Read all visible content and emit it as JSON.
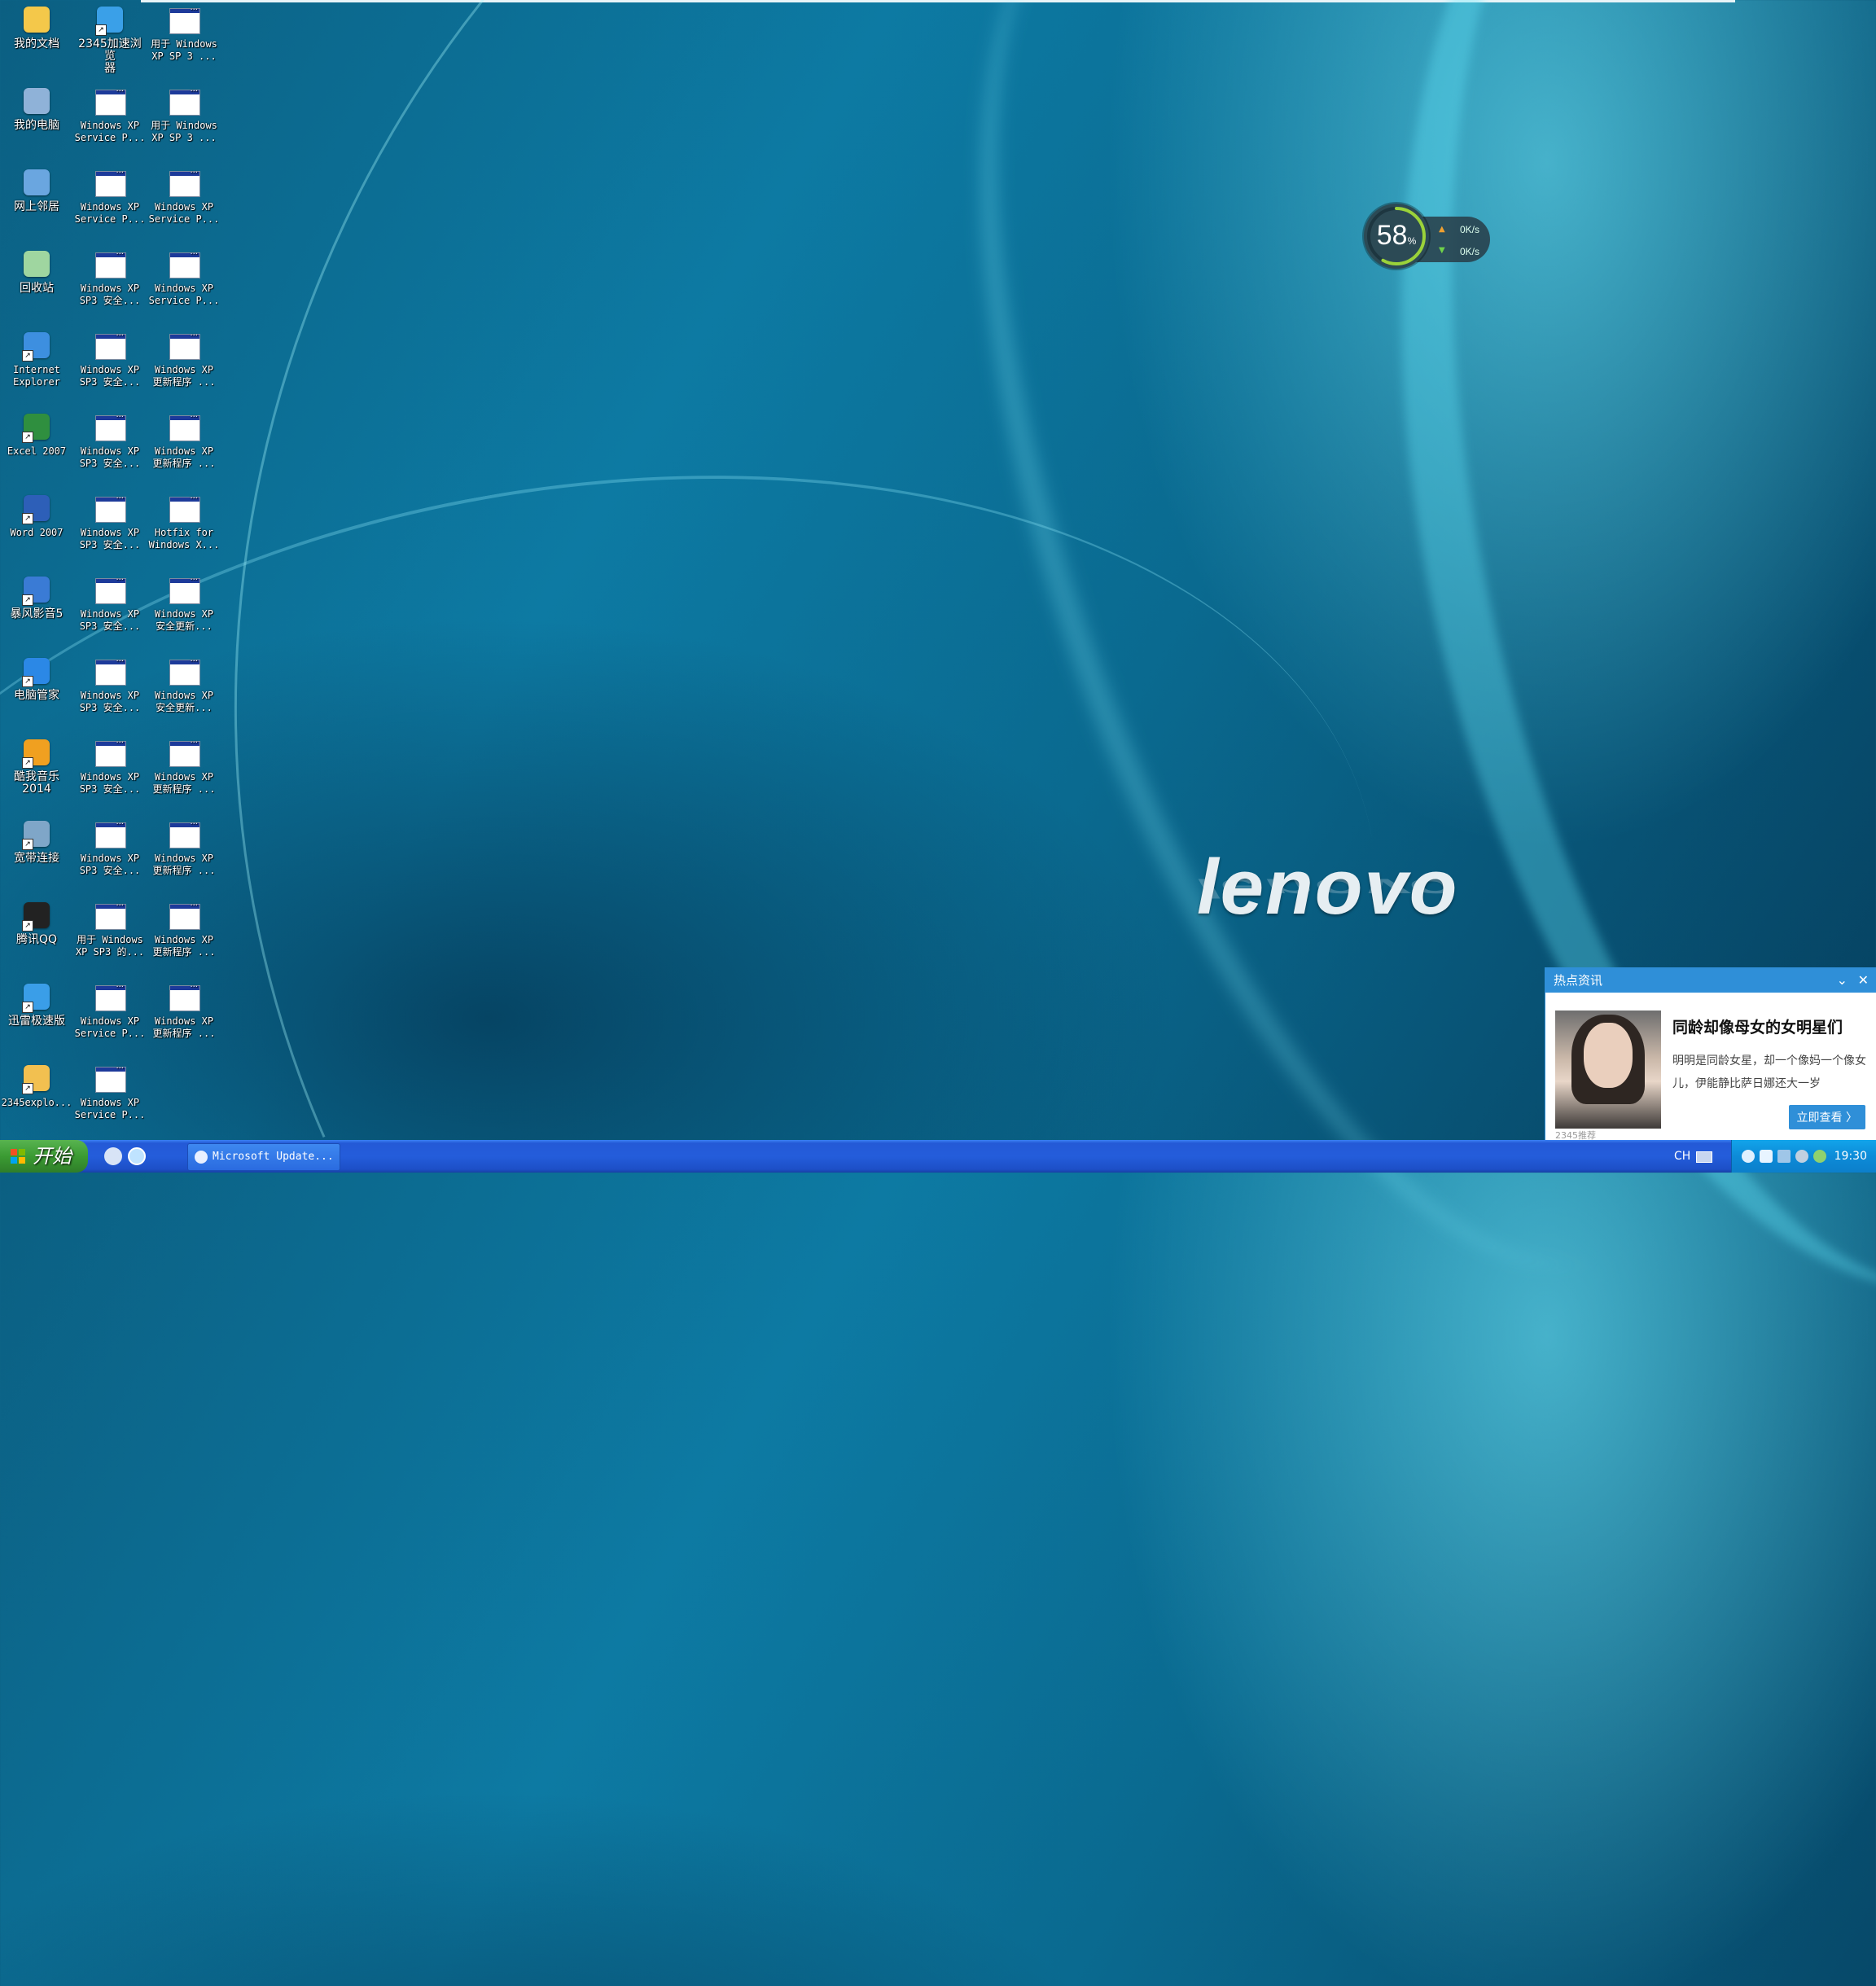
{
  "desktop": {
    "col1": [
      {
        "label": "我的文档",
        "icon": "my-documents-icon"
      },
      {
        "label": "我的电脑",
        "icon": "my-computer-icon"
      },
      {
        "label": "网上邻居",
        "icon": "network-places-icon"
      },
      {
        "label": "回收站",
        "icon": "recycle-bin-icon"
      },
      {
        "label": "Internet\nExplorer",
        "icon": "internet-explorer-icon"
      },
      {
        "label": "Excel 2007",
        "icon": "excel-icon"
      },
      {
        "label": "Word 2007",
        "icon": "word-icon"
      },
      {
        "label": "暴风影音5",
        "icon": "baofeng-player-icon"
      },
      {
        "label": "电脑管家",
        "icon": "pc-manager-icon"
      },
      {
        "label": "酷我音乐\n2014",
        "icon": "kuwo-music-icon"
      },
      {
        "label": "宽带连接",
        "icon": "broadband-icon"
      },
      {
        "label": "腾讯QQ",
        "icon": "qq-icon"
      },
      {
        "label": "迅雷极速版",
        "icon": "thunder-icon"
      },
      {
        "label": "2345explo...",
        "icon": "2345-explorer-icon"
      }
    ],
    "col2": [
      {
        "label": "2345加速浏览\n器",
        "icon": "2345-browser-icon"
      },
      {
        "label": "Windows XP\nService P...",
        "icon": "installer-window-icon"
      },
      {
        "label": "Windows XP\nService P...",
        "icon": "installer-window-icon"
      },
      {
        "label": "Windows XP\nSP3 安全...",
        "icon": "installer-window-icon"
      },
      {
        "label": "Windows XP\nSP3 安全...",
        "icon": "installer-window-icon"
      },
      {
        "label": "Windows XP\nSP3 安全...",
        "icon": "installer-window-icon"
      },
      {
        "label": "Windows XP\nSP3 安全...",
        "icon": "installer-window-icon"
      },
      {
        "label": "Windows XP\nSP3 安全...",
        "icon": "installer-window-icon"
      },
      {
        "label": "Windows XP\nSP3 安全...",
        "icon": "installer-window-icon"
      },
      {
        "label": "Windows XP\nSP3 安全...",
        "icon": "installer-window-icon"
      },
      {
        "label": "Windows XP\nSP3 安全...",
        "icon": "installer-window-icon"
      },
      {
        "label": "用于 Windows\nXP SP3 的...",
        "icon": "installer-window-icon"
      },
      {
        "label": "Windows XP\nService P...",
        "icon": "installer-window-icon"
      },
      {
        "label": "Windows XP\nService P...",
        "icon": "installer-window-icon"
      }
    ],
    "col3": [
      {
        "label": "用于 Windows\nXP SP 3 ...",
        "icon": "installer-window-icon"
      },
      {
        "label": "用于 Windows\nXP SP 3 ...",
        "icon": "installer-window-icon"
      },
      {
        "label": "Windows XP\nService P...",
        "icon": "installer-window-icon"
      },
      {
        "label": "Windows XP\nService P...",
        "icon": "installer-window-icon"
      },
      {
        "label": "Windows XP\n更新程序 ...",
        "icon": "installer-window-icon"
      },
      {
        "label": "Windows XP\n更新程序 ...",
        "icon": "installer-window-icon"
      },
      {
        "label": "Hotfix for\nWindows X...",
        "icon": "installer-window-icon"
      },
      {
        "label": "Windows XP\n安全更新...",
        "icon": "installer-window-icon"
      },
      {
        "label": "Windows XP\n安全更新...",
        "icon": "installer-window-icon"
      },
      {
        "label": "Windows XP\n更新程序 ...",
        "icon": "installer-window-icon"
      },
      {
        "label": "Windows XP\n更新程序 ...",
        "icon": "installer-window-icon"
      },
      {
        "label": "Windows XP\n更新程序 ...",
        "icon": "installer-window-icon"
      },
      {
        "label": "Windows XP\n更新程序 ...",
        "icon": "installer-window-icon"
      }
    ]
  },
  "speed_widget": {
    "percent": "58",
    "percent_unit": "%",
    "percent_value": 58,
    "upload": "0K/s",
    "download": "0K/s"
  },
  "wallpaper": {
    "brand": "lenovo"
  },
  "news_popup": {
    "header": "热点资讯",
    "title": "同龄却像母女的女明星们",
    "description": "明明是同龄女星，却一个像妈一个像女儿，伊能静比萨日娜还大一岁",
    "source": "2345推荐",
    "action": "立即查看 〉"
  },
  "taskbar": {
    "start_label": "开始",
    "task_label": "Microsoft Update...",
    "ime": "CH",
    "clock": "19:30"
  },
  "colors": {
    "taskbar_blue": "#245ddb",
    "start_green": "#3b9b33",
    "accent_blue": "#2f8fd8"
  }
}
